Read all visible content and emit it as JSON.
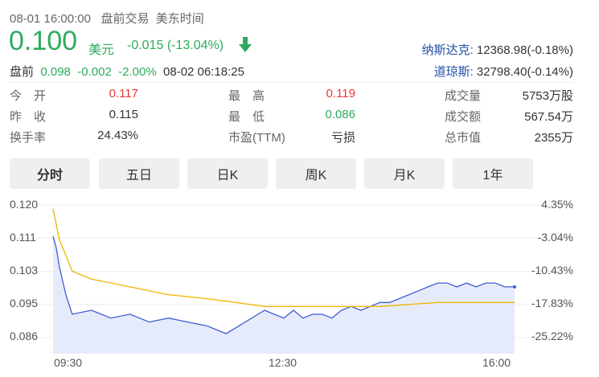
{
  "header": {
    "datetime": "08-01 16:00:00",
    "session": "盘前交易",
    "timezone": "美东时间"
  },
  "price": {
    "value": "0.100",
    "currency": "美元",
    "change": "-0.015",
    "change_pct": "(-13.04%)",
    "direction_icon": "arrow-down-icon"
  },
  "premarket": {
    "label": "盘前",
    "price": "0.098",
    "change": "-0.002",
    "change_pct": "-2.00%",
    "time": "08-02 06:18:25"
  },
  "indices": [
    {
      "name": "纳斯达克:",
      "value": "12368.98(-0.18%)"
    },
    {
      "name": "道琼斯:",
      "value": "32798.40(-0.14%)"
    }
  ],
  "stats": {
    "open_label": "今　开",
    "open": "0.117",
    "prev_close_label": "昨　收",
    "prev_close": "0.115",
    "turnover_label": "换手率",
    "turnover": "24.43%",
    "high_label": "最　高",
    "high": "0.119",
    "low_label": "最　低",
    "low": "0.086",
    "pe_label": "市盈(TTM)",
    "pe": "亏损",
    "volume_label": "成交量",
    "volume": "5753万股",
    "amount_label": "成交额",
    "amount": "567.54万",
    "mcap_label": "总市值",
    "mcap": "2355万"
  },
  "tabs": [
    "分时",
    "五日",
    "日K",
    "周K",
    "月K",
    "1年"
  ],
  "active_tab": "分时",
  "colors": {
    "price_line": "#3f5fd0",
    "avg_line": "#f0b400",
    "area_fill": "#e6ebfb",
    "down": "#2eaa5c",
    "up": "#e53935"
  },
  "chart_data": {
    "type": "line",
    "y_ticks": [
      "0.120",
      "0.111",
      "0.103",
      "0.095",
      "0.086"
    ],
    "y_pct_ticks": [
      "4.35%",
      "-3.04%",
      "-10.43%",
      "-17.83%",
      "-25.22%"
    ],
    "x_ticks": [
      "09:30",
      "12:30",
      "16:00"
    ],
    "ylim": [
      0.086,
      0.12
    ],
    "xlim": [
      "04:00",
      "16:00"
    ],
    "series": [
      {
        "name": "",
        "x": [
          "04:00",
          "04:05",
          "04:10",
          "04:20",
          "04:30",
          "05:00",
          "05:30",
          "06:00",
          "06:30",
          "07:00",
          "07:30",
          "08:00",
          "08:30",
          "09:00",
          "09:30",
          "09:45",
          "10:00",
          "10:15",
          "10:30",
          "10:45",
          "11:00",
          "11:15",
          "11:30",
          "11:45",
          "12:00",
          "12:15",
          "12:30",
          "12:45",
          "13:00",
          "13:15",
          "13:30",
          "13:45",
          "14:00",
          "14:15",
          "14:30",
          "14:45",
          "15:00",
          "15:15",
          "15:30",
          "15:45",
          "16:00"
        ],
        "values": [
          0.112,
          0.109,
          0.104,
          0.097,
          0.092,
          0.093,
          0.091,
          0.092,
          0.09,
          0.091,
          0.09,
          0.089,
          0.087,
          0.09,
          0.093,
          0.092,
          0.091,
          0.093,
          0.091,
          0.092,
          0.092,
          0.091,
          0.093,
          0.094,
          0.093,
          0.094,
          0.095,
          0.095,
          0.096,
          0.097,
          0.098,
          0.099,
          0.1,
          0.1,
          0.099,
          0.1,
          0.099,
          0.1,
          0.1,
          0.099,
          0.099
        ]
      },
      {
        "name": "",
        "x": [
          "04:00",
          "04:10",
          "04:30",
          "05:00",
          "06:00",
          "07:00",
          "08:00",
          "09:30",
          "12:30",
          "14:00",
          "16:00"
        ],
        "values": [
          0.119,
          0.111,
          0.103,
          0.101,
          0.099,
          0.097,
          0.096,
          0.094,
          0.094,
          0.095,
          0.095
        ]
      }
    ]
  }
}
